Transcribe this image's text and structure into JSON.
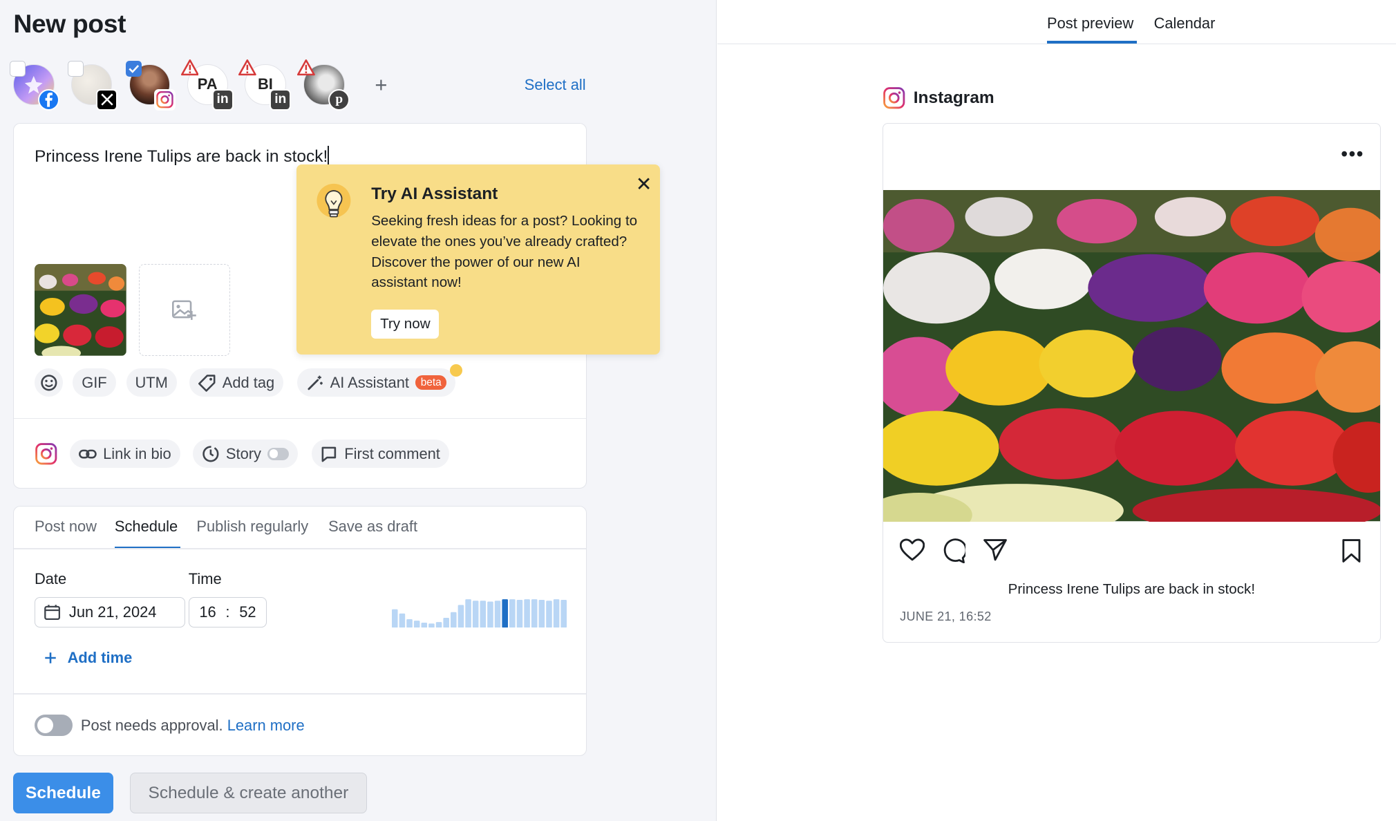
{
  "composer": {
    "page_title": "New post",
    "accounts": [
      {
        "network": "facebook",
        "checked": false,
        "warning": false,
        "initials": ""
      },
      {
        "network": "x",
        "checked": false,
        "warning": false,
        "initials": ""
      },
      {
        "network": "instagram",
        "checked": true,
        "warning": false,
        "initials": ""
      },
      {
        "network": "linkedin",
        "checked": false,
        "warning": true,
        "initials": "PA"
      },
      {
        "network": "linkedin",
        "checked": false,
        "warning": true,
        "initials": "BI"
      },
      {
        "network": "pinterest",
        "checked": false,
        "warning": true,
        "initials": ""
      }
    ],
    "add_account_label": "+",
    "select_all_label": "Select all",
    "post_text": "Princess Irene Tulips are back in stock!",
    "tools": {
      "gif": "GIF",
      "utm": "UTM",
      "add_tag": "Add tag",
      "ai_assistant": "AI Assistant",
      "beta_badge": "beta"
    },
    "instagram_options": {
      "link_in_bio": "Link in bio",
      "story": "Story",
      "first_comment": "First comment"
    }
  },
  "ai_popup": {
    "title": "Try AI Assistant",
    "body": "Seeking fresh ideas for a post? Looking to elevate the ones you’ve already crafted? Discover the power of our new AI assistant now!",
    "cta": "Try now",
    "close_label": "✕"
  },
  "schedule": {
    "tabs": [
      "Post now",
      "Schedule",
      "Publish regularly",
      "Save as draft"
    ],
    "active_tab": "Schedule",
    "date_label": "Date",
    "time_label": "Time",
    "date_value": "Jun 21, 2024",
    "hour": "16",
    "minute": "52",
    "time_separator": ":",
    "add_time_label": "Add time",
    "activity_bars": [
      0.65,
      0.5,
      0.3,
      0.25,
      0.18,
      0.15,
      0.2,
      0.35,
      0.55,
      0.8,
      1.0,
      0.95,
      0.95,
      0.92,
      0.95,
      1.0,
      1.0,
      0.98,
      1.0,
      1.0,
      0.98,
      0.95,
      1.0,
      0.98
    ],
    "activity_highlight_index": 15,
    "approval_text": "Post needs approval.",
    "approval_link": "Learn more",
    "approval_enabled": false
  },
  "actions": {
    "primary": "Schedule",
    "secondary": "Schedule & create another"
  },
  "preview": {
    "tabs": [
      "Post preview",
      "Calendar"
    ],
    "active_tab": "Post preview",
    "network_title": "Instagram",
    "caption": "Princess Irene Tulips are back in stock!",
    "date": "JUNE 21, 16:52"
  },
  "colors": {
    "accent": "#1f6fc5",
    "primary_button": "#3b8ee8",
    "popup_bg": "#f8dd88",
    "warning": "#d63a3a"
  }
}
